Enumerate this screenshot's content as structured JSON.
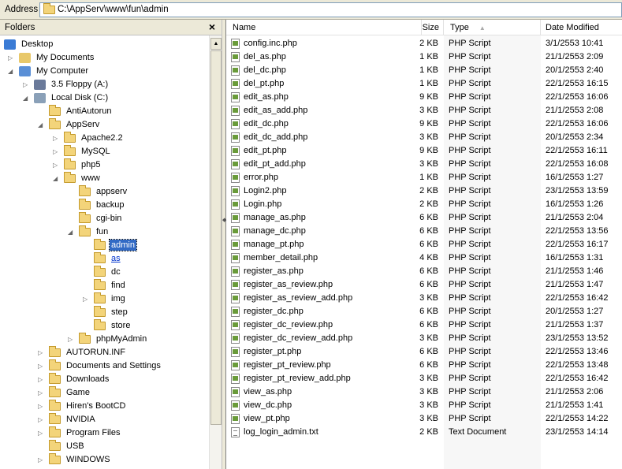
{
  "address": {
    "label": "Address",
    "path": "C:\\AppServ\\www\\fun\\admin"
  },
  "folders_pane": {
    "title": "Folders",
    "close": "×"
  },
  "tree": [
    {
      "label": "Desktop",
      "level": 0,
      "exp": "",
      "icon": "desktop"
    },
    {
      "label": "My Documents",
      "level": 1,
      "exp": "closed",
      "icon": "mydocs"
    },
    {
      "label": "My Computer",
      "level": 1,
      "exp": "open",
      "icon": "computer"
    },
    {
      "label": "3.5 Floppy (A:)",
      "level": 2,
      "exp": "closed",
      "icon": "floppy"
    },
    {
      "label": "Local Disk (C:)",
      "level": 2,
      "exp": "open",
      "icon": "disk"
    },
    {
      "label": "AntiAutorun",
      "level": 3,
      "exp": "",
      "icon": "folder"
    },
    {
      "label": "AppServ",
      "level": 3,
      "exp": "open",
      "icon": "folder"
    },
    {
      "label": "Apache2.2",
      "level": 4,
      "exp": "closed",
      "icon": "folder"
    },
    {
      "label": "MySQL",
      "level": 4,
      "exp": "closed",
      "icon": "folder"
    },
    {
      "label": "php5",
      "level": 4,
      "exp": "closed",
      "icon": "folder"
    },
    {
      "label": "www",
      "level": 4,
      "exp": "open",
      "icon": "folder"
    },
    {
      "label": "appserv",
      "level": 5,
      "exp": "",
      "icon": "folder"
    },
    {
      "label": "backup",
      "level": 5,
      "exp": "",
      "icon": "folder"
    },
    {
      "label": "cgi-bin",
      "level": 5,
      "exp": "",
      "icon": "folder"
    },
    {
      "label": "fun",
      "level": 5,
      "exp": "open",
      "icon": "folder"
    },
    {
      "label": "admin",
      "level": 6,
      "exp": "",
      "icon": "folder",
      "state": "selected"
    },
    {
      "label": "as",
      "level": 6,
      "exp": "",
      "icon": "folder",
      "state": "hover"
    },
    {
      "label": "dc",
      "level": 6,
      "exp": "",
      "icon": "folder"
    },
    {
      "label": "find",
      "level": 6,
      "exp": "",
      "icon": "folder"
    },
    {
      "label": "img",
      "level": 6,
      "exp": "closed",
      "icon": "folder"
    },
    {
      "label": "step",
      "level": 6,
      "exp": "",
      "icon": "folder"
    },
    {
      "label": "store",
      "level": 6,
      "exp": "",
      "icon": "folder"
    },
    {
      "label": "phpMyAdmin",
      "level": 5,
      "exp": "closed",
      "icon": "folder"
    },
    {
      "label": "AUTORUN.INF",
      "level": 3,
      "exp": "closed",
      "icon": "folder"
    },
    {
      "label": "Documents and Settings",
      "level": 3,
      "exp": "closed",
      "icon": "folder"
    },
    {
      "label": "Downloads",
      "level": 3,
      "exp": "closed",
      "icon": "folder"
    },
    {
      "label": "Game",
      "level": 3,
      "exp": "closed",
      "icon": "folder"
    },
    {
      "label": "Hiren's BootCD",
      "level": 3,
      "exp": "closed",
      "icon": "folder"
    },
    {
      "label": "NVIDIA",
      "level": 3,
      "exp": "closed",
      "icon": "folder"
    },
    {
      "label": "Program Files",
      "level": 3,
      "exp": "closed",
      "icon": "folder"
    },
    {
      "label": "USB",
      "level": 3,
      "exp": "",
      "icon": "folder"
    },
    {
      "label": "WINDOWS",
      "level": 3,
      "exp": "closed",
      "icon": "folder"
    }
  ],
  "columns": {
    "name": "Name",
    "size": "Size",
    "type": "Type",
    "sort_icon": "▲",
    "date": "Date Modified"
  },
  "files": [
    {
      "name": "config.inc.php",
      "size": "2 KB",
      "type": "PHP Script",
      "date": "3/1/2553 10:41"
    },
    {
      "name": "del_as.php",
      "size": "1 KB",
      "type": "PHP Script",
      "date": "21/1/2553 2:09"
    },
    {
      "name": "del_dc.php",
      "size": "1 KB",
      "type": "PHP Script",
      "date": "20/1/2553 2:40"
    },
    {
      "name": "del_pt.php",
      "size": "1 KB",
      "type": "PHP Script",
      "date": "22/1/2553 16:15"
    },
    {
      "name": "edit_as.php",
      "size": "9 KB",
      "type": "PHP Script",
      "date": "22/1/2553 16:06"
    },
    {
      "name": "edit_as_add.php",
      "size": "3 KB",
      "type": "PHP Script",
      "date": "21/1/2553 2:08"
    },
    {
      "name": "edit_dc.php",
      "size": "9 KB",
      "type": "PHP Script",
      "date": "22/1/2553 16:06"
    },
    {
      "name": "edit_dc_add.php",
      "size": "3 KB",
      "type": "PHP Script",
      "date": "20/1/2553 2:34"
    },
    {
      "name": "edit_pt.php",
      "size": "9 KB",
      "type": "PHP Script",
      "date": "22/1/2553 16:11"
    },
    {
      "name": "edit_pt_add.php",
      "size": "3 KB",
      "type": "PHP Script",
      "date": "22/1/2553 16:08"
    },
    {
      "name": "error.php",
      "size": "1 KB",
      "type": "PHP Script",
      "date": "16/1/2553 1:27"
    },
    {
      "name": "Login2.php",
      "size": "2 KB",
      "type": "PHP Script",
      "date": "23/1/2553 13:59"
    },
    {
      "name": "Login.php",
      "size": "2 KB",
      "type": "PHP Script",
      "date": "16/1/2553 1:26"
    },
    {
      "name": "manage_as.php",
      "size": "6 KB",
      "type": "PHP Script",
      "date": "21/1/2553 2:04"
    },
    {
      "name": "manage_dc.php",
      "size": "6 KB",
      "type": "PHP Script",
      "date": "22/1/2553 13:56"
    },
    {
      "name": "manage_pt.php",
      "size": "6 KB",
      "type": "PHP Script",
      "date": "22/1/2553 16:17"
    },
    {
      "name": "member_detail.php",
      "size": "4 KB",
      "type": "PHP Script",
      "date": "16/1/2553 1:31"
    },
    {
      "name": "register_as.php",
      "size": "6 KB",
      "type": "PHP Script",
      "date": "21/1/2553 1:46"
    },
    {
      "name": "register_as_review.php",
      "size": "6 KB",
      "type": "PHP Script",
      "date": "21/1/2553 1:47"
    },
    {
      "name": "register_as_review_add.php",
      "size": "3 KB",
      "type": "PHP Script",
      "date": "22/1/2553 16:42"
    },
    {
      "name": "register_dc.php",
      "size": "6 KB",
      "type": "PHP Script",
      "date": "20/1/2553 1:27"
    },
    {
      "name": "register_dc_review.php",
      "size": "6 KB",
      "type": "PHP Script",
      "date": "21/1/2553 1:37"
    },
    {
      "name": "register_dc_review_add.php",
      "size": "3 KB",
      "type": "PHP Script",
      "date": "23/1/2553 13:52"
    },
    {
      "name": "register_pt.php",
      "size": "6 KB",
      "type": "PHP Script",
      "date": "22/1/2553 13:46"
    },
    {
      "name": "register_pt_review.php",
      "size": "6 KB",
      "type": "PHP Script",
      "date": "22/1/2553 13:48"
    },
    {
      "name": "register_pt_review_add.php",
      "size": "3 KB",
      "type": "PHP Script",
      "date": "22/1/2553 16:42"
    },
    {
      "name": "view_as.php",
      "size": "3 KB",
      "type": "PHP Script",
      "date": "21/1/2553 2:06"
    },
    {
      "name": "view_dc.php",
      "size": "3 KB",
      "type": "PHP Script",
      "date": "21/1/2553 1:41"
    },
    {
      "name": "view_pt.php",
      "size": "3 KB",
      "type": "PHP Script",
      "date": "22/1/2553 14:22"
    },
    {
      "name": "log_login_admin.txt",
      "size": "2 KB",
      "type": "Text Document",
      "date": "23/1/2553 14:14"
    }
  ]
}
